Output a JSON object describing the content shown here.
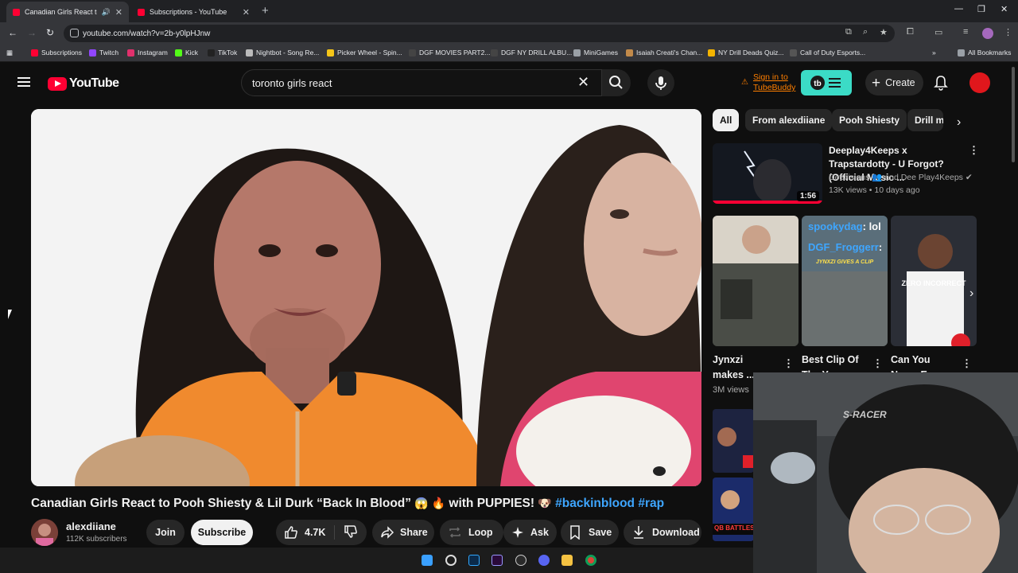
{
  "browser": {
    "tabs": [
      {
        "title": "Canadian Girls React to Pooh Shiesty &",
        "active": true
      },
      {
        "title": "Subscriptions - YouTube",
        "active": false
      }
    ],
    "url": "youtube.com/watch?v=2b-y0lpHJnw",
    "bookmarks": [
      {
        "label": "Subscriptions",
        "color": "#ff0033"
      },
      {
        "label": "Twitch",
        "color": "#9146ff"
      },
      {
        "label": "Instagram",
        "color": "#e1306c"
      },
      {
        "label": "Kick",
        "color": "#53fc18"
      },
      {
        "label": "TikTok",
        "color": "#222222"
      },
      {
        "label": "Nightbot - Song Re...",
        "color": "#bbbbbb"
      },
      {
        "label": "Picker Wheel - Spin...",
        "color": "#f5c518"
      },
      {
        "label": "DGF MOVIES PART2...",
        "color": "#444444"
      },
      {
        "label": "DGF NY DRILL ALBU...",
        "color": "#444444"
      },
      {
        "label": "MiniGames",
        "color": "#9aa0a6"
      },
      {
        "label": "Isaiah Creati's Chan...",
        "color": "#c28a4a"
      },
      {
        "label": "NY Drill Deads Quiz...",
        "color": "#f4b400"
      },
      {
        "label": "Call of Duty Esports...",
        "color": "#555555"
      }
    ],
    "all_bookmarks": "All Bookmarks"
  },
  "youtube": {
    "logo": "YouTube",
    "search_query": "toronto girls react",
    "tubebuddy_line1": "Sign in to",
    "tubebuddy_line2": "TubeBuddy",
    "create_label": "Create"
  },
  "video": {
    "title_main": "Canadian Girls React to Pooh Shiesty & Lil Durk “Back In Blood”",
    "title_emoji1": "😱 🔥",
    "title_mid": "with PUPPIES!",
    "title_emoji2": "🐶",
    "title_tags": "#backinblood #rap",
    "channel_name": "alexdiiane",
    "subscribers": "112K subscribers",
    "join_label": "Join",
    "subscribe_label": "Subscribe",
    "likes": "4.7K",
    "share_label": "Share",
    "loop_label": "Loop",
    "ask_label": "Ask",
    "save_label": "Save",
    "download_label": "Download"
  },
  "sidebar": {
    "chips": [
      "All",
      "From alexdiiane",
      "Pooh Shiesty",
      "Drill m"
    ],
    "recommended": {
      "title": "Deeplay4Keeps x Trapstardotty - U Forgot? (Official Music ...",
      "channel": "Deevisions 👥 and Dee Play4Keeps",
      "meta": "13K views • 10 days ago",
      "duration": "1:56"
    },
    "shorts": [
      {
        "title": "Jynxzi makes ..."
      },
      {
        "title": "Best Clip Of The Year"
      },
      {
        "title": "Can You Name Ever..."
      }
    ],
    "shorts_views": "3M views",
    "short_overlay_text": "QB BATTLES"
  },
  "overlay_texts": {
    "chat1_user": "spookydag",
    "chat1_msg": ": lol",
    "chat2_user": "DGF_Froggerr",
    "chat2_msg": ":",
    "cam_text": "S-RACER"
  }
}
